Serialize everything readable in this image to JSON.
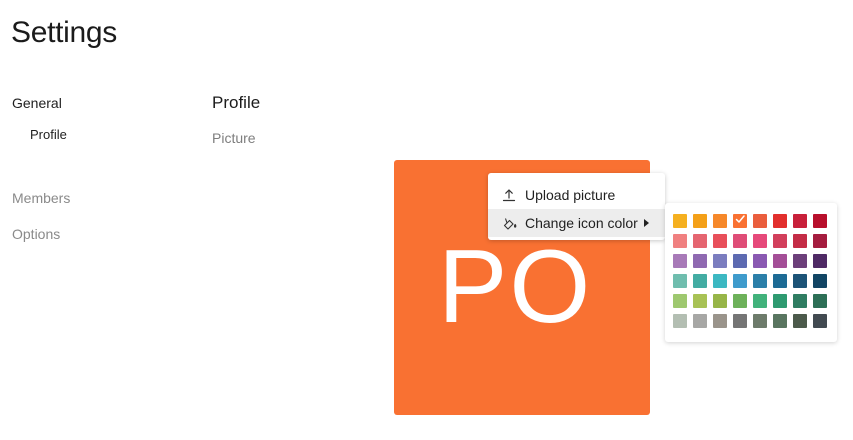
{
  "page": {
    "title": "Settings"
  },
  "sidebar": {
    "items": [
      {
        "label": "General"
      },
      {
        "label": "Profile"
      },
      {
        "label": "Members"
      },
      {
        "label": "Options"
      }
    ]
  },
  "main": {
    "section_title": "Profile",
    "picture_label": "Picture",
    "avatar": {
      "initials": "PO",
      "background_color": "#f97132"
    }
  },
  "context_menu": {
    "items": [
      {
        "label": "Upload picture",
        "icon": "upload-icon"
      },
      {
        "label": "Change icon color",
        "icon": "paint-bucket-icon",
        "has_submenu": true
      }
    ]
  },
  "color_palette": {
    "selected": "#f97132",
    "rows": [
      [
        "#f5b020",
        "#f4a018",
        "#f6882a",
        "#f97132",
        "#ea5e3d",
        "#e22f2d",
        "#c8203a",
        "#b80f2c"
      ],
      [
        "#f08080",
        "#e56570",
        "#e84f5a",
        "#df4d77",
        "#e6497a",
        "#d23f5b",
        "#c42c46",
        "#a51c3f"
      ],
      [
        "#a87ab8",
        "#8f69b1",
        "#7b7dbf",
        "#5d6ab1",
        "#8a59b2",
        "#a44e97",
        "#6c3f7a",
        "#4f2a65"
      ],
      [
        "#6fbdae",
        "#43aca3",
        "#3cb8c2",
        "#3f9bcc",
        "#2b7fa9",
        "#1d6b95",
        "#1c5377",
        "#124564"
      ],
      [
        "#9ec86f",
        "#a8c255",
        "#97b548",
        "#6db15a",
        "#41b27b",
        "#2e9a70",
        "#2f7d62",
        "#2d6f56"
      ],
      [
        "#b3beb2",
        "#a7a7a5",
        "#9a948b",
        "#757575",
        "#6d7b6b",
        "#597560",
        "#4c5a4b",
        "#424a51"
      ]
    ]
  }
}
